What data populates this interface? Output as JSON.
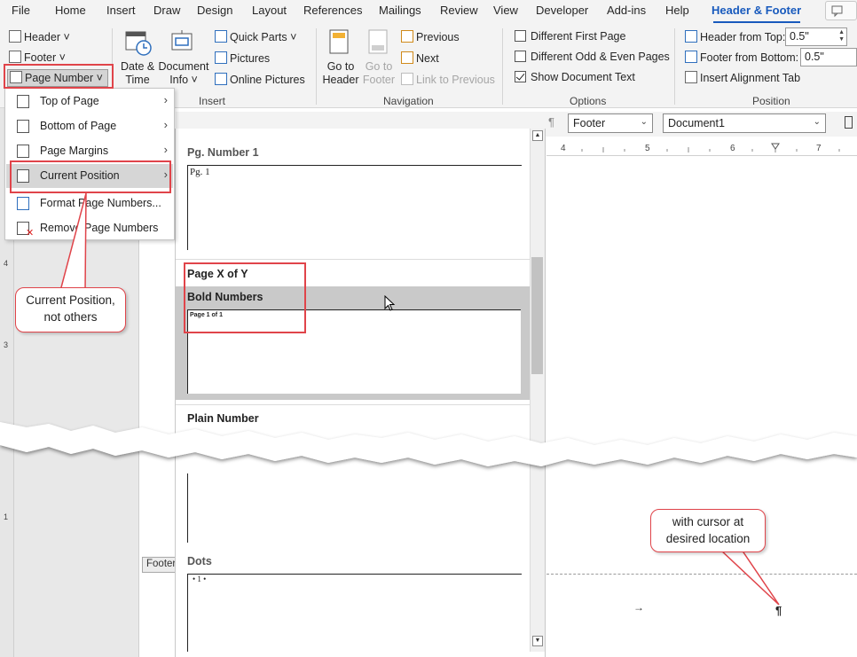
{
  "menubar": {
    "tabs": [
      "File",
      "Home",
      "Insert",
      "Draw",
      "Design",
      "Layout",
      "References",
      "Mailings",
      "Review",
      "View",
      "Developer",
      "Add-ins",
      "Help",
      "Header & Footer"
    ],
    "active_tab": "Header & Footer"
  },
  "ribbon": {
    "header_footer_group": {
      "header": "Header ˅",
      "footer": "Footer ˅",
      "page_number": "Page Number ˅"
    },
    "insert_group": {
      "label": "Insert",
      "date_time_line1": "Date &",
      "date_time_line2": "Time",
      "doc_info_line1": "Document",
      "doc_info_line2": "Info ˅",
      "quick_parts": "Quick Parts ˅",
      "pictures": "Pictures",
      "online_pictures": "Online Pictures"
    },
    "navigation_group": {
      "label": "Navigation",
      "goto_header_line1": "Go to",
      "goto_header_line2": "Header",
      "goto_footer_line1": "Go to",
      "goto_footer_line2": "Footer",
      "previous": "Previous",
      "next": "Next",
      "link_previous": "Link to Previous"
    },
    "options_group": {
      "label": "Options",
      "different_first_page": "Different First Page",
      "different_odd_even": "Different Odd & Even Pages",
      "show_document_text": "Show Document Text",
      "show_document_text_checked": true
    },
    "position_group": {
      "label": "Position",
      "header_from_top_label": "Header from Top:",
      "header_from_top_value": "0.5\"",
      "footer_from_bottom_label": "Footer from Bottom:",
      "footer_from_bottom_value": "0.5\"",
      "insert_alignment_tab": "Insert Alignment Tab"
    }
  },
  "toolbar2": {
    "pilcrow": "¶",
    "style_select": "Footer",
    "document_select": "Document1"
  },
  "ruler": {
    "ticks": [
      "4",
      "5",
      "6",
      "7"
    ]
  },
  "left_ruler": {
    "marks": [
      "4",
      "3",
      "1"
    ]
  },
  "page_number_menu": {
    "items": [
      {
        "label": "Top of Page",
        "submenu": true
      },
      {
        "label": "Bottom of Page",
        "submenu": true
      },
      {
        "label": "Page Margins",
        "submenu": true
      },
      {
        "label": "Current Position",
        "submenu": true
      },
      {
        "label": "Format Page Numbers...",
        "submenu": false
      },
      {
        "label": "Remove Page Numbers",
        "submenu": false
      }
    ],
    "submenu_arrow": "›"
  },
  "gallery": {
    "pg_number_1": {
      "title": "Pg. Number 1",
      "sample": "Pg. 1"
    },
    "section_page_x_of_y": "Page X of Y",
    "bold_numbers": {
      "title": "Bold Numbers",
      "sample": "Page 1 of 1"
    },
    "plain_number": "Plain Number",
    "dots": {
      "title": "Dots",
      "sample": "• 1 •"
    }
  },
  "document": {
    "footer_tab": "Footer",
    "tab_arrow": "→",
    "pilcrow": "¶"
  },
  "callouts": {
    "current_position": "Current Position, not others",
    "cursor": "with cursor at desired location"
  },
  "colors": {
    "accent": "#185abd",
    "annotation_red": "#e0444a",
    "hover_gray": "#c9c9c9"
  }
}
